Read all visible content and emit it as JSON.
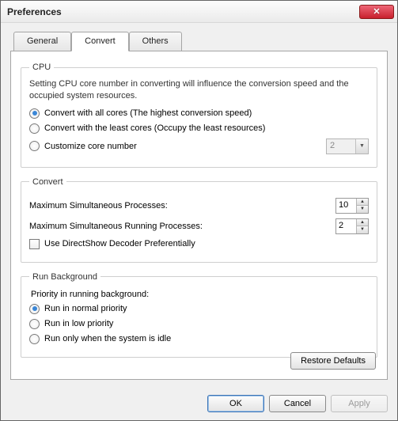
{
  "window": {
    "title": "Preferences"
  },
  "tabs": {
    "general": "General",
    "convert": "Convert",
    "others": "Others",
    "active": "convert"
  },
  "cpu": {
    "legend": "CPU",
    "desc": "Setting CPU core number in converting will influence the conversion speed and the occupied system resources.",
    "opt_all": "Convert with all cores (The highest conversion speed)",
    "opt_least": "Convert with the least cores (Occupy the least resources)",
    "opt_custom": "Customize core number",
    "custom_value": "2",
    "selected": "all"
  },
  "convert": {
    "legend": "Convert",
    "max_proc_label": "Maximum Simultaneous Processes:",
    "max_proc_value": "10",
    "max_run_label": "Maximum Simultaneous Running Processes:",
    "max_run_value": "2",
    "directshow_label": "Use DirectShow Decoder Preferentially"
  },
  "runbg": {
    "legend": "Run Background",
    "priority_label": "Priority in running background:",
    "opt_normal": "Run in normal priority",
    "opt_low": "Run in low priority",
    "opt_idle": "Run only when the system is idle",
    "selected": "normal"
  },
  "buttons": {
    "restore": "Restore Defaults",
    "ok": "OK",
    "cancel": "Cancel",
    "apply": "Apply"
  }
}
